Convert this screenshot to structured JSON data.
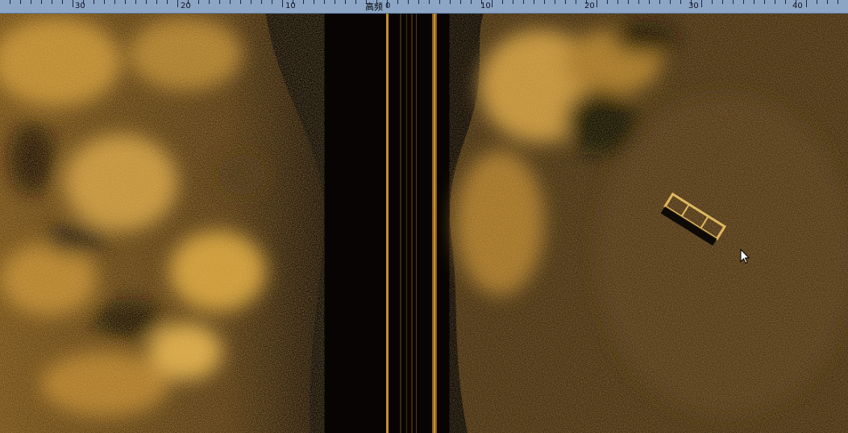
{
  "ruler": {
    "mode_label": "高频",
    "ticks_port": [
      "30",
      "20",
      "10"
    ],
    "center_tick": "0",
    "ticks_starboard": [
      "10",
      "20",
      "30",
      "40"
    ]
  },
  "sonar": {
    "palette": {
      "dark": "#0a0604",
      "mid": "#6e4a14",
      "bright": "#d9a548",
      "water_line": "#c89030"
    }
  }
}
